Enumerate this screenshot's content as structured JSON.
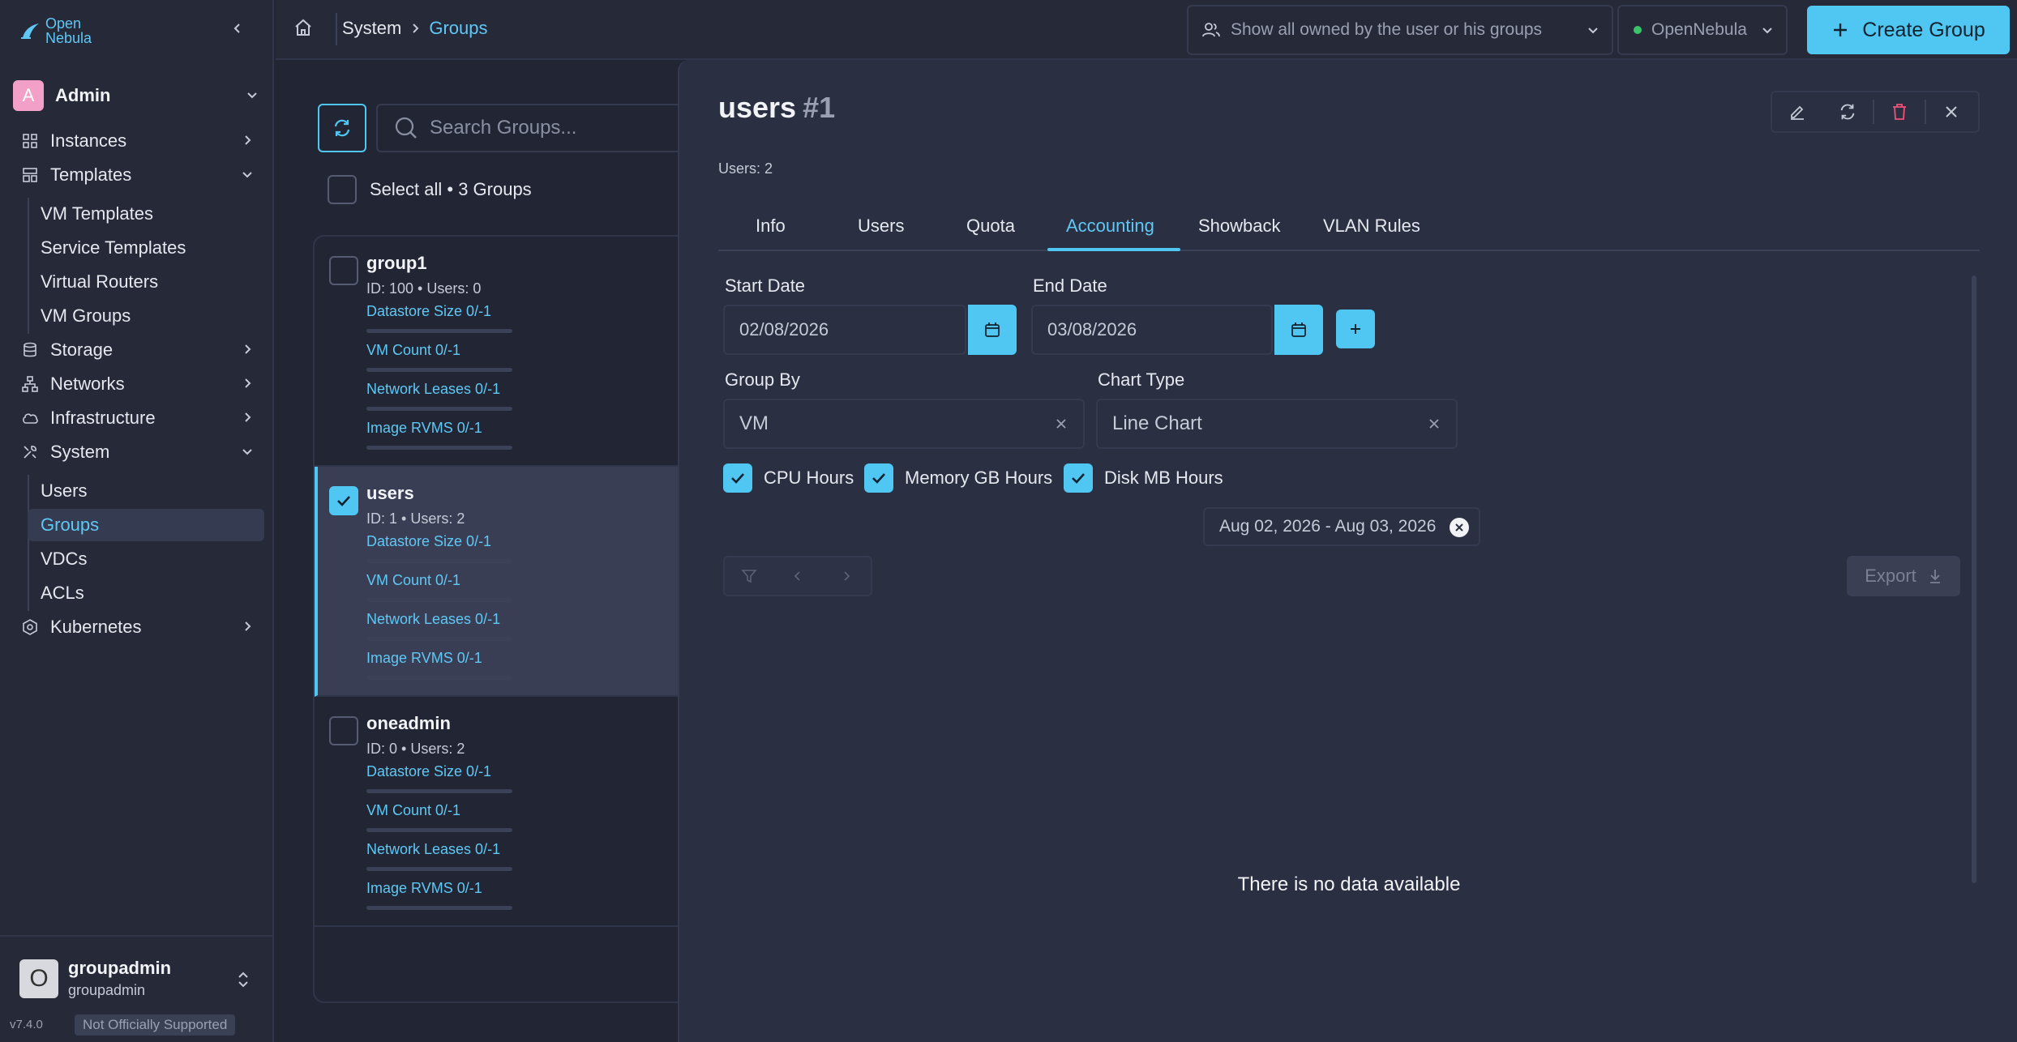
{
  "sidebar": {
    "logo_line1": "Open",
    "logo_line2": "Nebula",
    "user_view": "Admin",
    "user_view_initial": "A",
    "nav": {
      "instances": "Instances",
      "templates": "Templates",
      "templates_sub": [
        "VM Templates",
        "Service Templates",
        "Virtual Routers",
        "VM Groups"
      ],
      "storage": "Storage",
      "networks": "Networks",
      "infrastructure": "Infrastructure",
      "system": "System",
      "system_sub": [
        "Users",
        "Groups",
        "VDCs",
        "ACLs"
      ],
      "kubernetes": "Kubernetes"
    },
    "footer": {
      "avatar_initial": "O",
      "name": "groupadmin",
      "group": "groupadmin",
      "version": "v7.4.0",
      "support_badge": "Not Officially Supported"
    }
  },
  "topbar": {
    "breadcrumb": [
      "System",
      "Groups"
    ],
    "owner_filter": "Show all owned by the user or his groups",
    "zone": "OpenNebula",
    "create_label": "Create Group"
  },
  "list": {
    "search_placeholder": "Search Groups...",
    "select_all": "Select all • 3 Groups",
    "groups": [
      {
        "name": "group1",
        "meta": "ID: 100 • Users: 0",
        "selected": false,
        "quotas": [
          "Datastore Size 0/-1",
          "VM Count 0/-1",
          "Network Leases 0/-1",
          "Image RVMS 0/-1"
        ]
      },
      {
        "name": "users",
        "meta": "ID: 1 • Users: 2",
        "selected": true,
        "quotas": [
          "Datastore Size 0/-1",
          "VM Count 0/-1",
          "Network Leases 0/-1",
          "Image RVMS 0/-1"
        ]
      },
      {
        "name": "oneadmin",
        "meta": "ID: 0 • Users: 2",
        "selected": false,
        "quotas": [
          "Datastore Size 0/-1",
          "VM Count 0/-1",
          "Network Leases 0/-1",
          "Image RVMS 0/-1"
        ]
      }
    ]
  },
  "detail": {
    "title": "users",
    "id": "#1",
    "subtitle": "Users: 2",
    "tabs": [
      "Info",
      "Users",
      "Quota",
      "Accounting",
      "Showback",
      "VLAN Rules"
    ],
    "active_tab": "Accounting",
    "start_date_label": "Start Date",
    "start_date": "02/08/2026",
    "end_date_label": "End Date",
    "end_date": "03/08/2026",
    "group_by_label": "Group By",
    "group_by": "VM",
    "chart_type_label": "Chart Type",
    "chart_type": "Line Chart",
    "metrics": [
      "CPU Hours",
      "Memory GB Hours",
      "Disk MB Hours"
    ],
    "date_range_chip": "Aug 02, 2026 - Aug 03, 2026",
    "export_label": "Export",
    "no_data": "There is no data available"
  },
  "colors": {
    "accent": "#4fc7f2",
    "background": "#222634",
    "panel": "#2a2f42",
    "danger": "#f0527a"
  }
}
